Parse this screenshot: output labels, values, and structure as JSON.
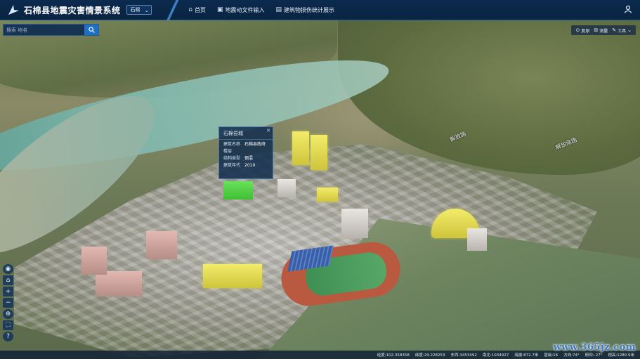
{
  "header": {
    "title": "石棉县地震灾害情景系统",
    "area_select": "石棉",
    "nav": [
      {
        "label": "首页",
        "icon": "home-icon"
      },
      {
        "label": "地震动文件输入",
        "icon": "folder-icon"
      },
      {
        "label": "建筑物损伤统计展示",
        "icon": "chart-icon"
      }
    ],
    "user_icon": "user-icon"
  },
  "search": {
    "placeholder": "搜索 地名"
  },
  "toolbar": {
    "items": [
      {
        "label": "复原",
        "icon": "reset-icon"
      },
      {
        "label": "测量",
        "icon": "ruler-icon"
      },
      {
        "label": "工具",
        "icon": "wrench-icon"
      }
    ]
  },
  "popup": {
    "title": "石棉县城",
    "rows": [
      {
        "key": "建筑名称",
        "value": "石棉县政府"
      },
      {
        "key": "楼层",
        "value": ""
      },
      {
        "key": "结构类型",
        "value": "钢混"
      },
      {
        "key": "建筑年代",
        "value": "2010"
      }
    ]
  },
  "map_labels": [
    "解放南路",
    "解放路"
  ],
  "status": {
    "lon": "经度:102.358358",
    "lat": "纬度:29.228253",
    "east": "东西:3453492",
    "north": "南北:1034927",
    "alt": "海拔:872.7米",
    "level": "层级:16",
    "heading": "方向:74°",
    "pitch": "俯仰:-27°",
    "view": "视高:1280.9米"
  },
  "watermark": "www.365jz.com",
  "colors": {
    "topbar": "#0a2442",
    "accent": "#1f6fc4",
    "highlight_yellow": "#e8e055",
    "highlight_green": "#5fd24f"
  }
}
